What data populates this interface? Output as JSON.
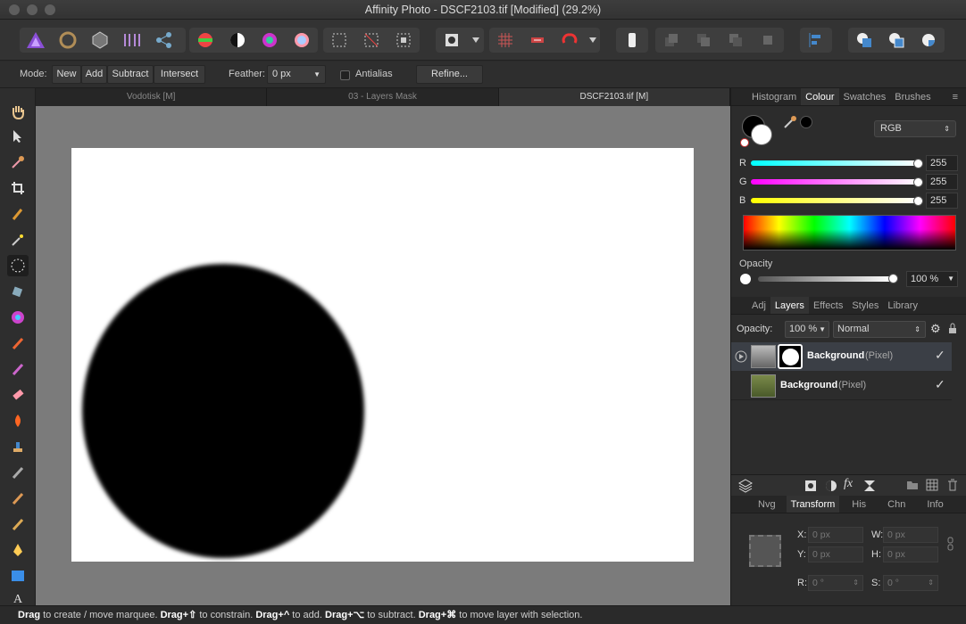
{
  "window": {
    "title": "Affinity Photo - DSCF2103.tif [Modified] (29.2%)"
  },
  "context": {
    "mode_label": "Mode:",
    "modes": [
      "New",
      "Add",
      "Subtract",
      "Intersect"
    ],
    "feather_label": "Feather:",
    "feather_value": "0 px",
    "antialias_label": "Antialias",
    "refine_label": "Refine..."
  },
  "tabs": [
    "Vodotisk [M]",
    "03 - Layers Mask",
    "DSCF2103.tif [M]"
  ],
  "colour_panel": {
    "tabs": [
      "Histogram",
      "Colour",
      "Swatches",
      "Brushes"
    ],
    "model": "RGB",
    "channels": [
      {
        "label": "R",
        "value": "255"
      },
      {
        "label": "G",
        "value": "255"
      },
      {
        "label": "B",
        "value": "255"
      }
    ],
    "opacity_label": "Opacity",
    "opacity_value": "100 %"
  },
  "layers_panel": {
    "tabs": [
      "Adj",
      "Layers",
      "Effects",
      "Styles",
      "Library"
    ],
    "opacity_label": "Opacity:",
    "opacity_value": "100 %",
    "blend_mode": "Normal",
    "layers": [
      {
        "name": "Background",
        "type": "(Pixel)"
      },
      {
        "name": "Background",
        "type": "(Pixel)"
      }
    ]
  },
  "transform_panel": {
    "tabs": [
      "Nvg",
      "Transform",
      "His",
      "Chn",
      "Info"
    ],
    "x_label": "X:",
    "x_value": "0 px",
    "y_label": "Y:",
    "y_value": "0 px",
    "w_label": "W:",
    "w_value": "0 px",
    "h_label": "H:",
    "h_value": "0 px",
    "r_label": "R:",
    "r_value": "0 °",
    "s_label": "S:",
    "s_value": "0 °"
  },
  "status": {
    "k1": "Drag",
    "t1": " to create / move marquee. ",
    "k2": "Drag+⇧",
    "t2": " to constrain. ",
    "k3": "Drag+^",
    "t3": " to add. ",
    "k4": "Drag+⌥",
    "t4": " to subtract. ",
    "k5": "Drag+⌘",
    "t5": " to move layer with selection."
  }
}
